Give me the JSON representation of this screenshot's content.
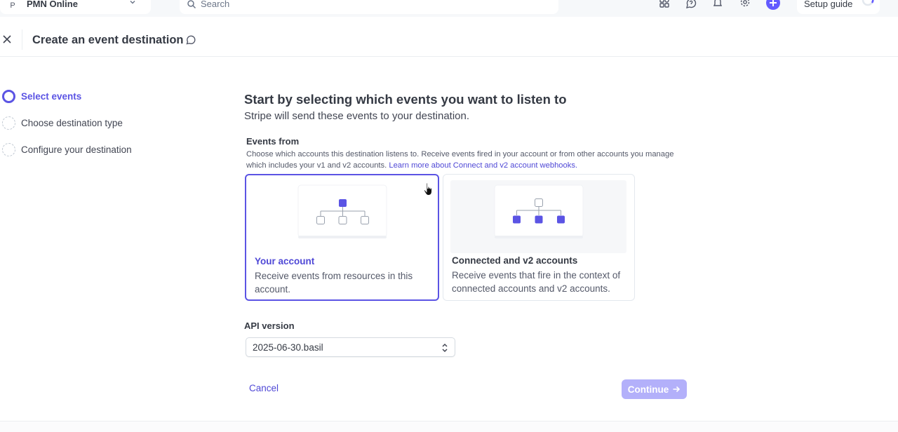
{
  "topbar": {
    "account_initial": "P",
    "account_name": "PMN Online",
    "search_placeholder": "Search",
    "setup_guide_label": "Setup guide",
    "icons": [
      "apps-icon",
      "help-icon",
      "notifications-icon",
      "settings-icon",
      "create-icon"
    ]
  },
  "header": {
    "title": "Create an event destination"
  },
  "steps": [
    {
      "label": "Select events",
      "state": "active"
    },
    {
      "label": "Choose destination type",
      "state": "pending"
    },
    {
      "label": "Configure your destination",
      "state": "pending"
    }
  ],
  "main": {
    "title": "Start by selecting which events you want to listen to",
    "subtitle": "Stripe will send these events to your destination.",
    "events_from": {
      "label": "Events from",
      "description": "Choose which accounts this destination listens to. Receive events fired in your account or from other accounts you manage which includes your v1 and v2 accounts.",
      "link_text": "Learn more about Connect and v2 account webhooks."
    },
    "cards": [
      {
        "title": "Your account",
        "description": "Receive events from resources in this account.",
        "selected": true
      },
      {
        "title": "Connected and v2 accounts",
        "description": "Receive events that fire in the context of connected accounts and v2 accounts.",
        "selected": false
      }
    ],
    "api_version": {
      "label": "API version",
      "value": "2025-06-30.basil"
    },
    "cancel_label": "Cancel",
    "continue_label": "Continue"
  },
  "colors": {
    "accent": "#5b54e4",
    "continue_disabled": "#b3b0fa",
    "link": "#4f48d6"
  }
}
